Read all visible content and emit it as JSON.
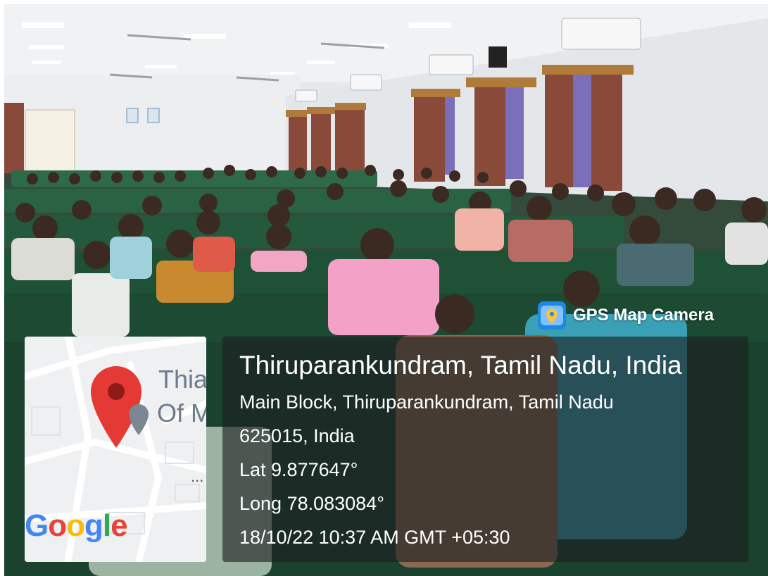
{
  "badge": {
    "label": "GPS Map Camera",
    "icon": "gps-map-camera-app-icon"
  },
  "location": {
    "title": "Thiruparankundram, Tamil Nadu, India",
    "address_line1": "Main Block, Thiruparankundram, Tamil Nadu",
    "address_line2": "625015, India",
    "latitude": "Lat 9.877647°",
    "longitude": "Long 78.083084°",
    "timestamp": "18/10/22 10:37 AM GMT +05:30"
  },
  "map": {
    "place_name_line1": "Thia",
    "place_name_line2": "Of M",
    "ellipsis": "...",
    "logo": {
      "letters": [
        "G",
        "o",
        "o",
        "g",
        "l",
        "e"
      ],
      "colors": [
        "#4285F4",
        "#EA4335",
        "#FBBC05",
        "#4285F4",
        "#34A853",
        "#EA4335"
      ]
    },
    "pin_color": "#E53935"
  },
  "colors": {
    "seat_green": "#1f5a3c",
    "curtain": "#8a4a3a",
    "wall": "#e8ebee"
  }
}
